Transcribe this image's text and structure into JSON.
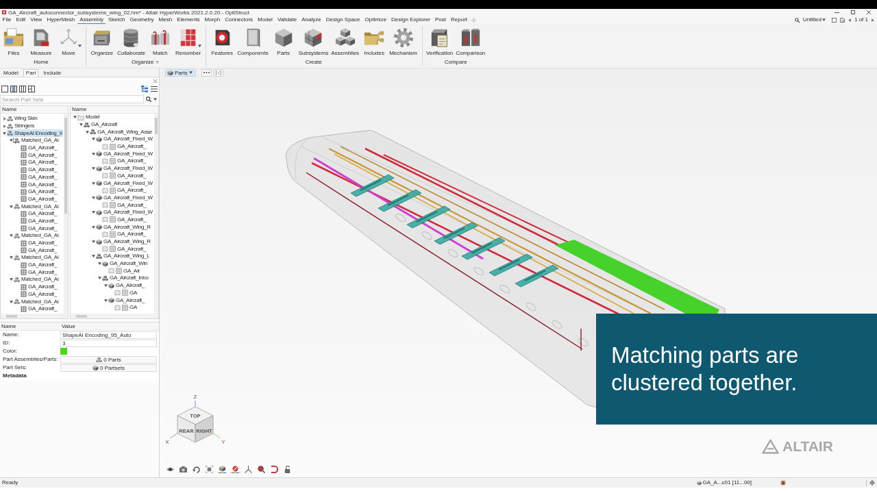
{
  "window": {
    "title": "GA_Aircraft_autoconnector_subsystems_wing_02.hm* - Altair HyperWorks 2021.2.0.20 - OptiStruct"
  },
  "menu_bar": {
    "items": [
      {
        "label": "File",
        "selected": false
      },
      {
        "label": "Edit",
        "selected": false
      },
      {
        "label": "View",
        "selected": false
      },
      {
        "label": "HyperMesh",
        "selected": false
      },
      {
        "label": "Assembly",
        "selected": true
      },
      {
        "label": "Sketch",
        "selected": false
      },
      {
        "label": "Geometry",
        "selected": false
      },
      {
        "label": "Mesh",
        "selected": false
      },
      {
        "label": "Elements",
        "selected": false
      },
      {
        "label": "Morph",
        "selected": false
      },
      {
        "label": "Connectors",
        "selected": false
      },
      {
        "label": "Model",
        "selected": false
      },
      {
        "label": "Validate",
        "selected": false
      },
      {
        "label": "Analyze",
        "selected": false
      },
      {
        "label": "Design Space",
        "selected": false
      },
      {
        "label": "Optimize",
        "selected": false
      },
      {
        "label": "Design Explorer",
        "selected": false
      },
      {
        "label": "Post",
        "selected": false
      },
      {
        "label": "Report",
        "selected": false
      }
    ],
    "document": "Untitled",
    "page_indicator": "1 of 1"
  },
  "ribbon": {
    "groups": [
      {
        "label": "Home",
        "has_menu": false,
        "tools": [
          {
            "label": "Files",
            "has_menu": false
          },
          {
            "label": "Measure",
            "has_menu": false
          },
          {
            "label": "Move",
            "has_menu": true
          }
        ]
      },
      {
        "label": "Organize",
        "has_menu": true,
        "tools": [
          {
            "label": "Organize",
            "has_menu": false
          },
          {
            "label": "Collaborate",
            "has_menu": false
          },
          {
            "label": "Match",
            "has_menu": false
          },
          {
            "label": "Renumber",
            "has_menu": true
          }
        ]
      },
      {
        "label": "Create",
        "has_menu": false,
        "tools": [
          {
            "label": "Features",
            "has_menu": false
          },
          {
            "label": "Components",
            "has_menu": false
          },
          {
            "label": "Parts",
            "has_menu": false
          },
          {
            "label": "Subsystems",
            "has_menu": false
          },
          {
            "label": "Assemblies",
            "has_menu": false
          },
          {
            "label": "Includes",
            "has_menu": false
          },
          {
            "label": "Mechanism",
            "has_menu": false
          }
        ]
      },
      {
        "label": "Compare",
        "has_menu": false,
        "tools": [
          {
            "label": "Verification",
            "has_menu": false
          },
          {
            "label": "Comparison",
            "has_menu": false
          }
        ]
      }
    ]
  },
  "panel_tabs": [
    {
      "label": "Model",
      "selected": false
    },
    {
      "label": "Part",
      "selected": true
    },
    {
      "label": "Include",
      "selected": false
    }
  ],
  "part_browser": {
    "layouts": [
      {
        "selected": false
      },
      {
        "selected": true
      },
      {
        "selected": false
      },
      {
        "selected": false
      }
    ],
    "views": [
      {
        "selected": true
      },
      {
        "selected": false
      }
    ],
    "search": {
      "placeholder": "Search Part Sets"
    },
    "part_sets": {
      "column": "Name",
      "items": [
        {
          "label": "Wing Skin",
          "kind": "partset",
          "expanded": false,
          "selected": false
        },
        {
          "label": "Stringers",
          "kind": "partset",
          "expanded": false,
          "selected": false
        },
        {
          "label": "ShapeAI Encoding_9",
          "kind": "partset",
          "expanded": true,
          "selected": true,
          "children": [
            {
              "label": "Matched_GA_Ai",
              "kind": "partset",
              "expanded": true,
              "selected": false,
              "children": [
                {
                  "label": "GA_Aircraft_",
                  "kind": "part",
                  "selected": false
                },
                {
                  "label": "GA_Aircraft_",
                  "kind": "part",
                  "selected": false
                },
                {
                  "label": "GA_Aircraft_",
                  "kind": "part",
                  "selected": false
                },
                {
                  "label": "GA_Aircraft_",
                  "kind": "part",
                  "selected": false
                },
                {
                  "label": "GA_Aircraft_",
                  "kind": "part",
                  "selected": false
                },
                {
                  "label": "GA_Aircraft_",
                  "kind": "part",
                  "selected": false
                },
                {
                  "label": "GA_Aircraft_",
                  "kind": "part",
                  "selected": false
                },
                {
                  "label": "GA_Aircraft_",
                  "kind": "part",
                  "selected": false
                }
              ]
            },
            {
              "label": "Matched_GA_Ai",
              "kind": "partset",
              "expanded": true,
              "selected": false,
              "children": [
                {
                  "label": "GA_Aircraft_",
                  "kind": "part",
                  "selected": false
                },
                {
                  "label": "GA_Aircraft_",
                  "kind": "part",
                  "selected": false
                },
                {
                  "label": "GA_Aircraft_",
                  "kind": "part",
                  "selected": false
                }
              ]
            },
            {
              "label": "Matched_GA_Ai",
              "kind": "partset",
              "expanded": true,
              "selected": false,
              "children": [
                {
                  "label": "GA_Aircraft_",
                  "kind": "part",
                  "selected": false
                },
                {
                  "label": "GA_Aircraft_",
                  "kind": "part",
                  "selected": false
                }
              ]
            },
            {
              "label": "Matched_GA_Ai",
              "kind": "partset",
              "expanded": true,
              "selected": false,
              "children": [
                {
                  "label": "GA_Aircraft_",
                  "kind": "part",
                  "selected": false
                },
                {
                  "label": "GA_Aircraft_",
                  "kind": "part",
                  "selected": false
                }
              ]
            },
            {
              "label": "Matched_GA_Ai",
              "kind": "partset",
              "expanded": true,
              "selected": false,
              "children": [
                {
                  "label": "GA_Aircraft_",
                  "kind": "part",
                  "selected": false
                },
                {
                  "label": "GA_Aircraft_",
                  "kind": "part",
                  "selected": false
                }
              ]
            },
            {
              "label": "Matched_GA_Ai",
              "kind": "partset",
              "expanded": true,
              "selected": false,
              "children": [
                {
                  "label": "GA_Aircraft_",
                  "kind": "part",
                  "selected": false
                }
              ]
            }
          ]
        }
      ]
    },
    "model": {
      "column": "Name",
      "items": [
        {
          "label": "Model",
          "kind": "model",
          "expanded": true,
          "selected": false,
          "children": [
            {
              "label": "GA_Aircraft",
              "kind": "assembly",
              "expanded": true,
              "selected": false,
              "children": [
                {
                  "label": "GA_Aircraft_Wing_Asse",
                  "kind": "assembly",
                  "expanded": true,
                  "selected": false,
                  "children": [
                    {
                      "label": "GA_Aircraft_Fixed_W",
                      "kind": "component",
                      "expanded": true,
                      "selected": false,
                      "children": [
                        {
                          "label": "GA_Aircraft_",
                          "kind": "part",
                          "selected": false
                        }
                      ]
                    },
                    {
                      "label": "GA_Aircraft_Fixed_W",
                      "kind": "component",
                      "expanded": true,
                      "selected": false,
                      "children": [
                        {
                          "label": "GA_Aircraft_",
                          "kind": "part",
                          "selected": false
                        }
                      ]
                    },
                    {
                      "label": "GA_Aircraft_Fixed_W",
                      "kind": "component",
                      "expanded": true,
                      "selected": false,
                      "children": [
                        {
                          "label": "GA_Aircraft_",
                          "kind": "part",
                          "selected": false
                        }
                      ]
                    },
                    {
                      "label": "GA_Aircraft_Fixed_W",
                      "kind": "component",
                      "expanded": true,
                      "selected": false,
                      "children": [
                        {
                          "label": "GA_Aircraft_",
                          "kind": "part",
                          "selected": false
                        }
                      ]
                    },
                    {
                      "label": "GA_Aircraft_Fixed_W",
                      "kind": "component",
                      "expanded": true,
                      "selected": false,
                      "children": [
                        {
                          "label": "GA_Aircraft_",
                          "kind": "part",
                          "selected": false
                        }
                      ]
                    },
                    {
                      "label": "GA_Aircraft_Fixed_W",
                      "kind": "component",
                      "expanded": true,
                      "selected": false,
                      "children": [
                        {
                          "label": "GA_Aircraft_",
                          "kind": "part",
                          "selected": false
                        }
                      ]
                    },
                    {
                      "label": "GA_Aircraft_Wing_R",
                      "kind": "component",
                      "expanded": true,
                      "selected": false,
                      "children": [
                        {
                          "label": "GA_Aircraft_",
                          "kind": "part",
                          "selected": false
                        }
                      ]
                    },
                    {
                      "label": "GA_Aircraft_Wing_R",
                      "kind": "component",
                      "expanded": true,
                      "selected": false,
                      "children": [
                        {
                          "label": "GA_Aircraft_",
                          "kind": "part",
                          "selected": false
                        }
                      ]
                    },
                    {
                      "label": "GA_Aircraft_Wing_L",
                      "kind": "assembly",
                      "expanded": true,
                      "selected": false,
                      "children": [
                        {
                          "label": "GA_Aircraft_Win",
                          "kind": "component",
                          "expanded": true,
                          "selected": false,
                          "children": [
                            {
                              "label": "GA_Air",
                              "kind": "part",
                              "selected": false
                            }
                          ]
                        },
                        {
                          "label": "GA_Aircraft_Inbo",
                          "kind": "assembly",
                          "expanded": true,
                          "selected": false,
                          "children": [
                            {
                              "label": "GA_Aircraft_",
                              "kind": "component",
                              "expanded": true,
                              "selected": false,
                              "children": [
                                {
                                  "label": "GA",
                                  "kind": "part",
                                  "selected": false
                                }
                              ]
                            },
                            {
                              "label": "GA_Aircraft_",
                              "kind": "component",
                              "expanded": true,
                              "selected": false,
                              "children": [
                                {
                                  "label": "GA",
                                  "kind": "part",
                                  "selected": false
                                }
                              ]
                            }
                          ]
                        }
                      ]
                    }
                  ]
                }
              ]
            }
          ]
        }
      ]
    }
  },
  "properties": {
    "columns": [
      "Name",
      "Value"
    ],
    "rows": [
      {
        "kind": "text",
        "label": "Name:",
        "value": "ShapeAI Encoding_95_Auto"
      },
      {
        "kind": "text",
        "label": "ID:",
        "value": "3"
      },
      {
        "kind": "color",
        "label": "Color:",
        "color": "#4cd41f"
      },
      {
        "kind": "link",
        "label": "Part Assemblies/Parts:",
        "value": "0 Parts"
      },
      {
        "kind": "link",
        "label": "Part Sets:",
        "value": "0 Partsets"
      },
      {
        "kind": "section",
        "label": "Metadata"
      }
    ]
  },
  "viewport": {
    "entity_filter": "Parts",
    "caption": "Matching parts are clustered together.",
    "logo": "ALTAIR",
    "axes": [
      "Z",
      "X",
      "Y"
    ],
    "cube_faces": [
      "TOP",
      "REAR",
      "RIGHT"
    ]
  },
  "status_bar": {
    "message": "Ready",
    "entity": "GA_A...c01 [11...00]"
  }
}
